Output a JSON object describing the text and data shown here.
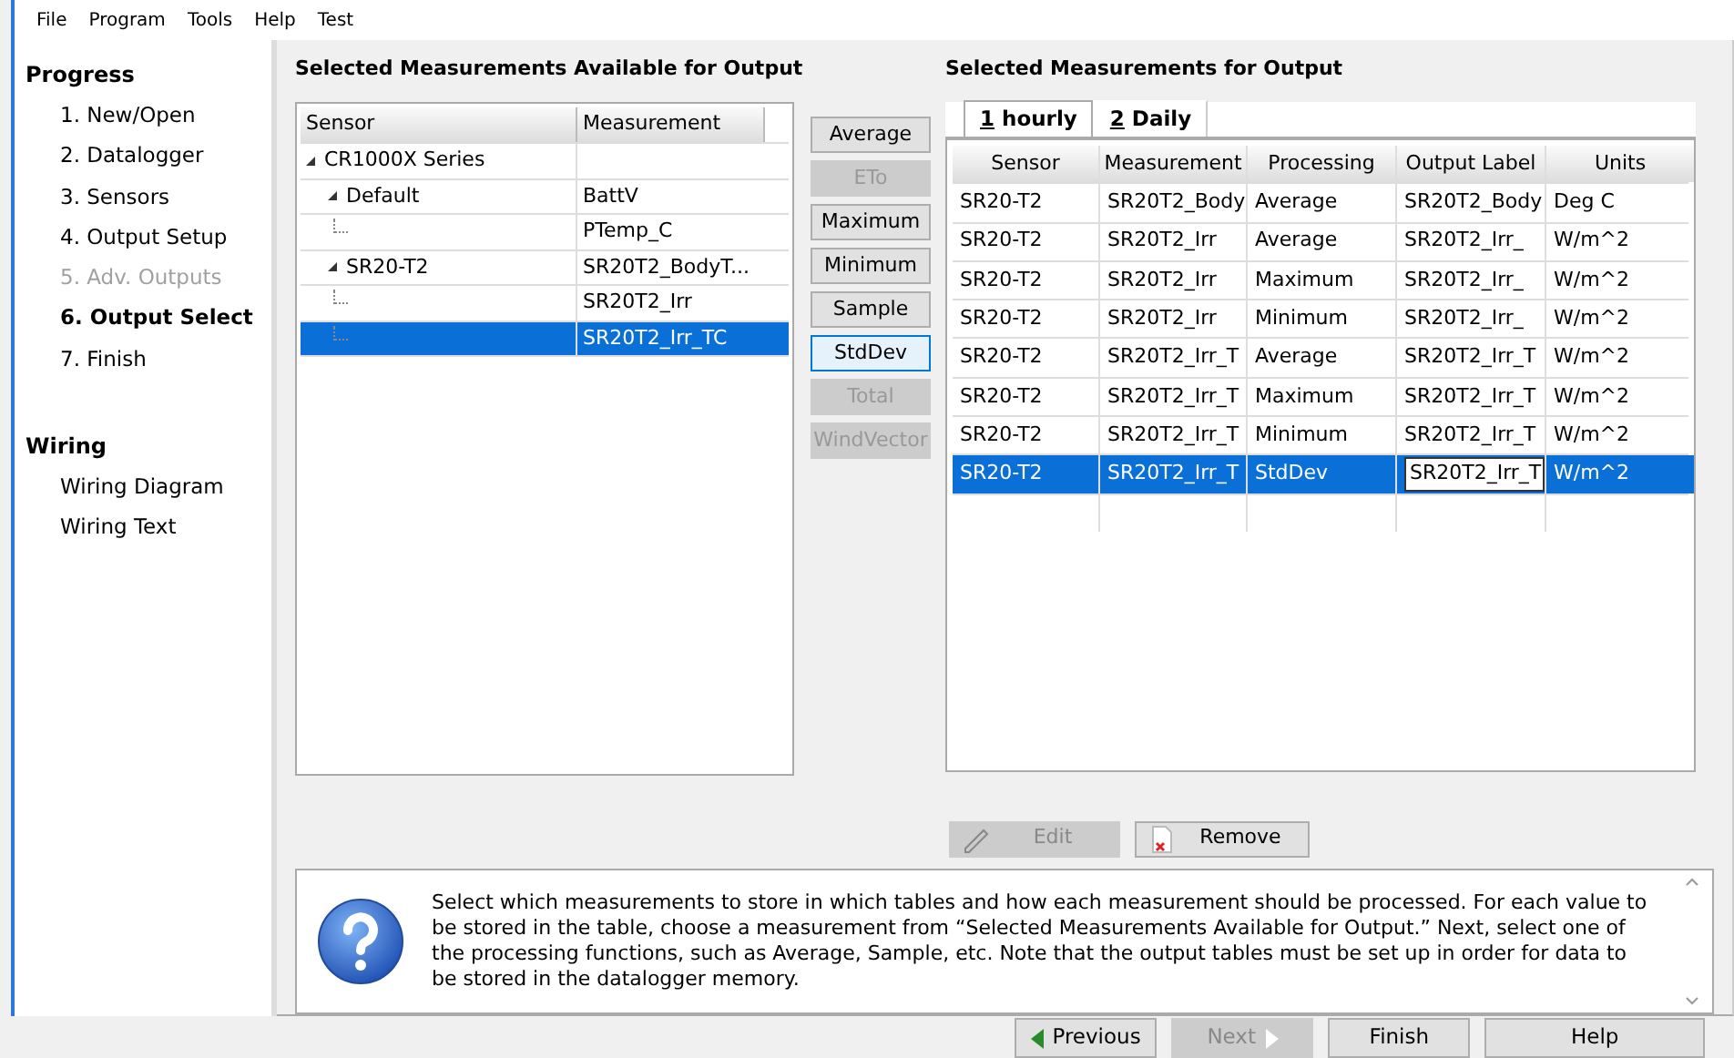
{
  "menu": [
    "File",
    "Program",
    "Tools",
    "Help",
    "Test"
  ],
  "sidebar": [
    {
      "heading": "Progress",
      "items": [
        {
          "label": "1. New/Open",
          "selected": false,
          "disabled": false
        },
        {
          "label": "2. Datalogger",
          "selected": false,
          "disabled": false
        },
        {
          "label": "3. Sensors",
          "selected": false,
          "disabled": false
        },
        {
          "label": "4. Output Setup",
          "selected": false,
          "disabled": false
        },
        {
          "label": "5. Adv. Outputs",
          "selected": false,
          "disabled": true
        },
        {
          "label": "6. Output Select",
          "selected": true,
          "disabled": false
        },
        {
          "label": "7. Finish",
          "selected": false,
          "disabled": false
        }
      ]
    },
    {
      "heading": "Wiring",
      "items": [
        {
          "label": "Wiring Diagram",
          "selected": false,
          "disabled": false
        },
        {
          "label": "Wiring Text",
          "selected": false,
          "disabled": false
        }
      ]
    }
  ],
  "available": {
    "title": "Selected Measurements Available for Output",
    "columns": [
      "Sensor",
      "Measurement"
    ],
    "tree": [
      {
        "sensor": "CR1000X Series",
        "expanded": true,
        "selected": false,
        "children": [
          {
            "sensor": "Default",
            "measurement": "BattV",
            "expanded": true,
            "selected": false,
            "children": [
              {
                "measurement": "PTemp_C",
                "selected": false
              }
            ]
          },
          {
            "sensor": "SR20-T2",
            "measurement": "SR20T2_BodyT...",
            "expanded": true,
            "selected": false,
            "children": [
              {
                "measurement": "SR20T2_Irr",
                "selected": false
              },
              {
                "measurement": "SR20T2_Irr_TC",
                "selected": true
              }
            ]
          }
        ]
      }
    ]
  },
  "processing": [
    {
      "label": "Average",
      "disabled": false,
      "selected": false
    },
    {
      "label": "ETo",
      "disabled": true,
      "selected": false
    },
    {
      "label": "Maximum",
      "disabled": false,
      "selected": false
    },
    {
      "label": "Minimum",
      "disabled": false,
      "selected": false
    },
    {
      "label": "Sample",
      "disabled": false,
      "selected": false
    },
    {
      "label": "StdDev",
      "disabled": false,
      "selected": true
    },
    {
      "label": "Total",
      "disabled": true,
      "selected": false
    },
    {
      "label": "WindVector",
      "disabled": true,
      "selected": false
    }
  ],
  "output": {
    "title": "Selected Measurements for Output",
    "tabs": [
      {
        "key": "1",
        "label": "hourly",
        "selected": true
      },
      {
        "key": "2",
        "label": "Daily",
        "selected": false
      }
    ],
    "columns": [
      "Sensor",
      "Measurement",
      "Processing",
      "Output Label",
      "Units"
    ],
    "rows": [
      {
        "cells": [
          "SR20-T2",
          "SR20T2_Body",
          "Average",
          "SR20T2_Body",
          "Deg C"
        ],
        "selected": false,
        "editing": false
      },
      {
        "cells": [
          "SR20-T2",
          "SR20T2_Irr",
          "Average",
          "SR20T2_Irr_",
          "W/m^2"
        ],
        "selected": false,
        "editing": false
      },
      {
        "cells": [
          "SR20-T2",
          "SR20T2_Irr",
          "Maximum",
          "SR20T2_Irr_",
          "W/m^2"
        ],
        "selected": false,
        "editing": false
      },
      {
        "cells": [
          "SR20-T2",
          "SR20T2_Irr",
          "Minimum",
          "SR20T2_Irr_",
          "W/m^2"
        ],
        "selected": false,
        "editing": false
      },
      {
        "cells": [
          "SR20-T2",
          "SR20T2_Irr_T",
          "Average",
          "SR20T2_Irr_T",
          "W/m^2"
        ],
        "selected": false,
        "editing": false
      },
      {
        "cells": [
          "SR20-T2",
          "SR20T2_Irr_T",
          "Maximum",
          "SR20T2_Irr_T",
          "W/m^2"
        ],
        "selected": false,
        "editing": false
      },
      {
        "cells": [
          "SR20-T2",
          "SR20T2_Irr_T",
          "Minimum",
          "SR20T2_Irr_T",
          "W/m^2"
        ],
        "selected": false,
        "editing": false
      },
      {
        "cells": [
          "SR20-T2",
          "SR20T2_Irr_T",
          "StdDev",
          "SR20T2_Irr_T",
          "W/m^2"
        ],
        "selected": true,
        "editing": true
      }
    ],
    "actions": [
      {
        "kind": "edit",
        "label": "Edit",
        "disabled": true
      },
      {
        "kind": "remove",
        "label": "Remove",
        "disabled": false
      }
    ]
  },
  "help": "Select which measurements to store in which tables and how each measurement should be processed. For each value to be stored in the table, choose a measurement from “Selected Measurements Available for Output.”  Next, select one of the processing functions, such as Average, Sample, etc. Note that the output tables must be set up in order for data to be stored in the datalogger memory.",
  "nav": [
    {
      "kind": "previous",
      "label": "Previous",
      "disabled": false
    },
    {
      "kind": "next",
      "label": "Next",
      "disabled": true
    },
    {
      "kind": "finish",
      "label": "Finish",
      "disabled": false
    },
    {
      "kind": "help",
      "label": "Help",
      "disabled": false
    }
  ]
}
